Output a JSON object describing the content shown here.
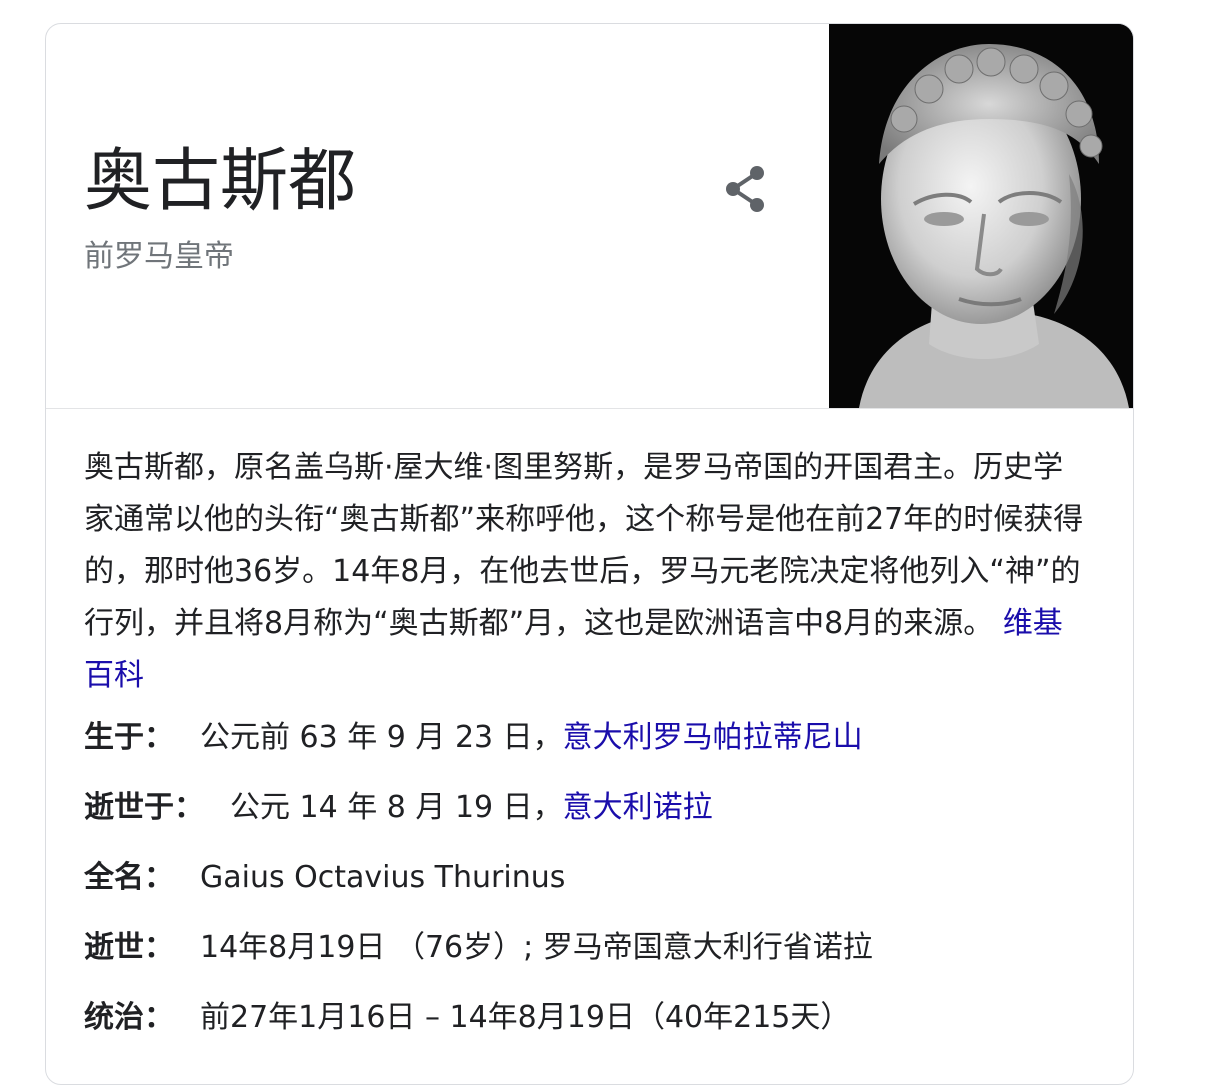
{
  "header": {
    "title": "奥古斯都",
    "subtitle": "前罗马皇帝"
  },
  "description": {
    "text": "奥古斯都，原名盖乌斯·屋大维·图里努斯，是罗马帝国的开国君主。历史学家通常以他的头衔“奥古斯都”来称呼他，这个称号是他在前27年的时候获得的，那时他36岁。14年8月，在他去世后，罗马元老院决定将他列入“神”的行列，并且将8月称为“奥古斯都”月，这也是欧洲语言中8月的来源。",
    "source_link": "维基百科"
  },
  "facts": [
    {
      "label": "生于：",
      "value": "公元前 63 年 9 月 23 日，",
      "link": "意大利罗马帕拉蒂尼山"
    },
    {
      "label": "逝世于：",
      "value": "公元 14 年 8 月 19 日，",
      "link": "意大利诺拉"
    },
    {
      "label": "全名：",
      "value": "Gaius Octavius Thurinus",
      "link": ""
    },
    {
      "label": "逝世：",
      "value": "14年8月19日 （76岁）; 罗马帝国意大利行省诺拉",
      "link": ""
    },
    {
      "label": "统治：",
      "value": "前27年1月16日 – 14年8月19日（40年215天）",
      "link": ""
    }
  ],
  "icons": {
    "share": "share-icon",
    "portrait": "marble-bust-image"
  }
}
